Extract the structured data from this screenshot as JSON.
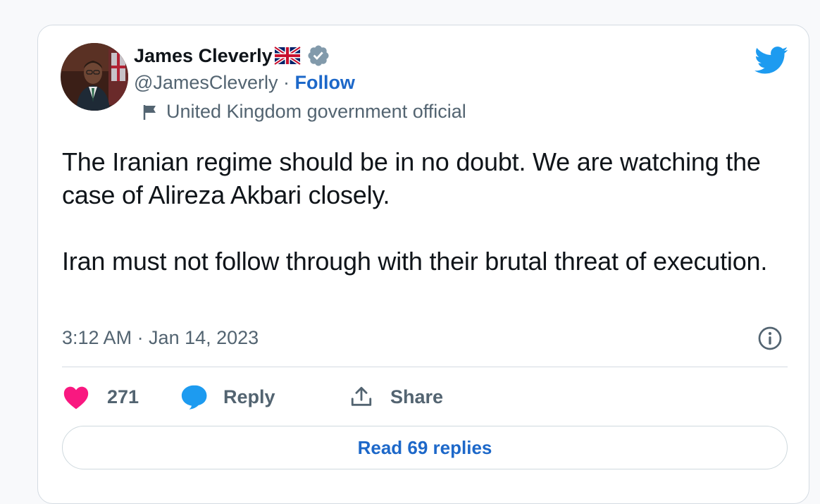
{
  "author": {
    "name": "James Cleverly",
    "handle": "@JamesCleverly",
    "separator": " · ",
    "follow_label": "Follow",
    "affiliation": "United Kingdom government official"
  },
  "tweet": {
    "text": "The Iranian regime should be in no doubt. We are watching the case of Alireza Akbari closely.\n\nIran must not follow through with their brutal threat of execution.",
    "timestamp": "3:12 AM · Jan 14, 2023"
  },
  "actions": {
    "like_count": "271",
    "reply_label": "Reply",
    "share_label": "Share"
  },
  "read_replies_label": "Read 69 replies",
  "icons": {
    "uk-flag-emoji": "uk-flag-icon",
    "verified-badge": "verified-icon",
    "affiliation": "flag-icon",
    "brand": "twitter-bird-icon",
    "info": "info-icon",
    "like": "heart-icon",
    "reply": "speech-bubble-icon",
    "share": "share-icon"
  },
  "colors": {
    "text_primary": "#0f1419",
    "text_secondary": "#536471",
    "link": "#1d68c9",
    "twitter_blue": "#1d9bf0",
    "like_pink": "#f91880",
    "verified_gray": "#829aab",
    "border": "#d4dbe2"
  }
}
